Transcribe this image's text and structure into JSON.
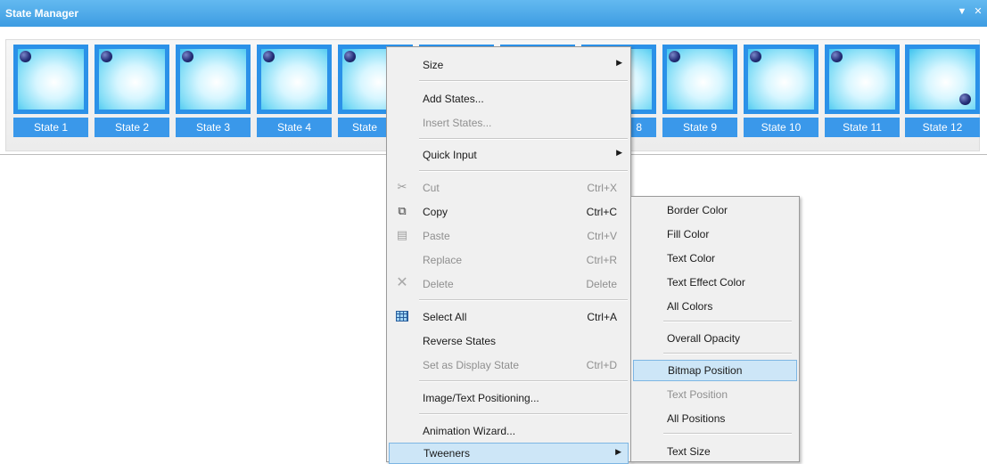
{
  "panel": {
    "title": "State Manager",
    "controls": {
      "dropdown_icon": "chevron-down-icon",
      "close_icon": "close-icon"
    }
  },
  "states": [
    {
      "label": "State 1"
    },
    {
      "label": "State 2"
    },
    {
      "label": "State 3"
    },
    {
      "label": "State 4"
    },
    {
      "label": "State"
    },
    {
      "label": ""
    },
    {
      "label": ""
    },
    {
      "label": "8"
    },
    {
      "label": "State 9"
    },
    {
      "label": "State 10"
    },
    {
      "label": "State 11"
    },
    {
      "label": "State 12"
    }
  ],
  "context_menu": {
    "size": "Size",
    "add_states": "Add States...",
    "insert_states": "Insert States...",
    "quick_input": "Quick Input",
    "cut": "Cut",
    "cut_sc": "Ctrl+X",
    "copy": "Copy",
    "copy_sc": "Ctrl+C",
    "paste": "Paste",
    "paste_sc": "Ctrl+V",
    "replace": "Replace",
    "replace_sc": "Ctrl+R",
    "delete": "Delete",
    "delete_sc": "Delete",
    "select_all": "Select All",
    "select_all_sc": "Ctrl+A",
    "reverse_states": "Reverse States",
    "set_display_state": "Set as Display State",
    "set_display_state_sc": "Ctrl+D",
    "image_text_positioning": "Image/Text Positioning...",
    "animation_wizard": "Animation Wizard...",
    "tweeners": "Tweeners"
  },
  "tweeners_submenu": {
    "border_color": "Border Color",
    "fill_color": "Fill Color",
    "text_color": "Text Color",
    "text_effect_color": "Text Effect Color",
    "all_colors": "All Colors",
    "overall_opacity": "Overall Opacity",
    "bitmap_position": "Bitmap Position",
    "text_position": "Text Position",
    "all_positions": "All Positions",
    "text_size": "Text Size"
  },
  "colors": {
    "title_bar": "#4aa8e8",
    "state_frame": "#2b91e8",
    "state_label_bg": "#3a98ea",
    "menu_bg": "#f0f0f0",
    "highlight": "#cde6f7"
  }
}
